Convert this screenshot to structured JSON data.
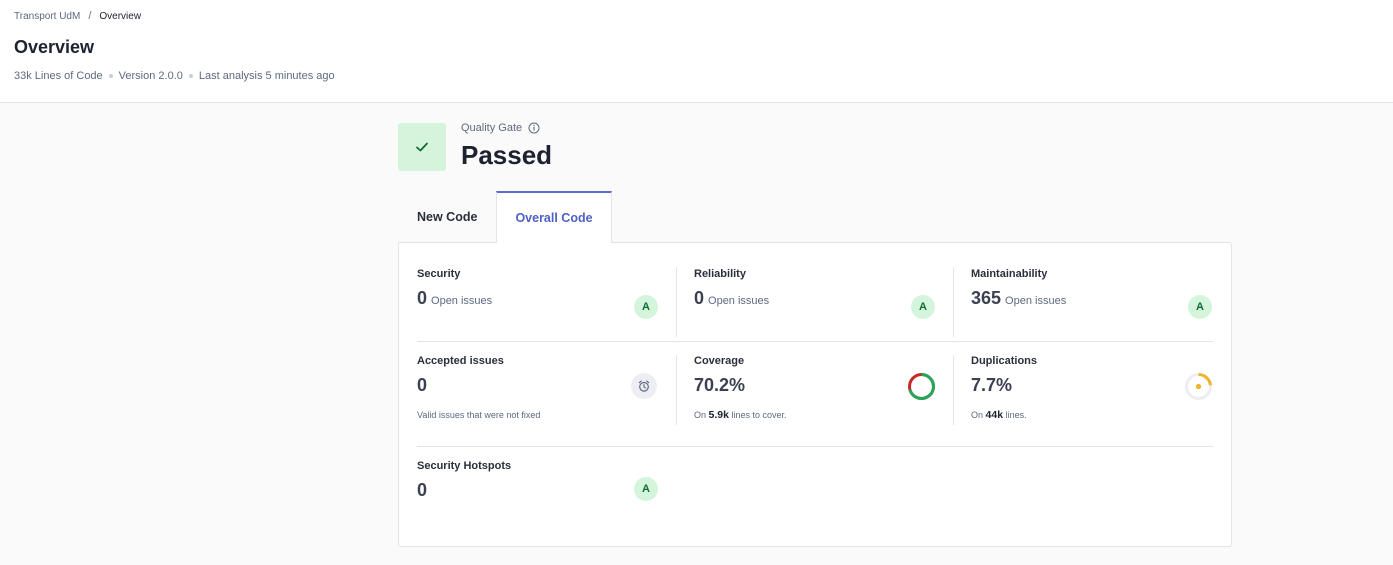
{
  "breadcrumb": {
    "project": "Transport UdM",
    "separator": "/",
    "current": "Overview"
  },
  "page": {
    "title": "Overview",
    "lines_of_code": "33k Lines of Code",
    "version": "Version 2.0.0",
    "last_analysis": "Last analysis 5 minutes ago"
  },
  "quality_gate": {
    "label": "Quality Gate",
    "status": "Passed",
    "color": "#d4f5dc"
  },
  "tabs": [
    {
      "label": "New Code",
      "active": false
    },
    {
      "label": "Overall Code",
      "active": true
    }
  ],
  "metrics": {
    "security": {
      "title": "Security",
      "value": "0",
      "suffix": "Open issues",
      "rating": "A"
    },
    "reliability": {
      "title": "Reliability",
      "value": "0",
      "suffix": "Open issues",
      "rating": "A"
    },
    "maintainability": {
      "title": "Maintainability",
      "value": "365",
      "suffix": "Open issues",
      "rating": "A"
    },
    "accepted": {
      "title": "Accepted issues",
      "value": "0",
      "note": "Valid issues that were not fixed",
      "icon": "alarm-clock-icon"
    },
    "coverage": {
      "title": "Coverage",
      "value": "70.2%",
      "note_prefix": "On",
      "note_strong": "5.9k",
      "note_suffix": "lines to cover.",
      "percent": 70.2
    },
    "duplications": {
      "title": "Duplications",
      "value": "7.7%",
      "note_prefix": "On",
      "note_strong": "44k",
      "note_suffix": "lines.",
      "percent": 7.7
    },
    "hotspots": {
      "title": "Security Hotspots",
      "value": "0",
      "rating": "A"
    }
  },
  "colors": {
    "accent": "#5d6cd0",
    "rating_bg": "#d4f5dc",
    "rating_fg": "#126b34",
    "coverage_good": "#23a85a",
    "coverage_bad": "#c62828",
    "duplication": "#f0b429"
  }
}
